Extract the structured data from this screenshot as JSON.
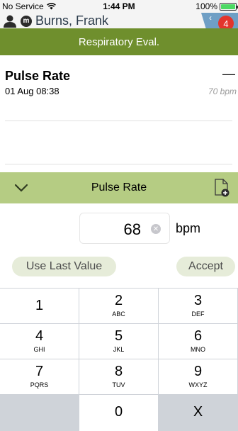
{
  "status_bar": {
    "carrier": "No Service",
    "time": "1:44 PM",
    "battery": "100%"
  },
  "patient": {
    "badge": "m",
    "name": "Burns, Frank",
    "notifications": "4"
  },
  "title": "Respiratory Eval.",
  "measurement": {
    "title": "Pulse Rate",
    "date": "01 Aug 08:38",
    "value": "—",
    "previous": "70 bpm"
  },
  "entry": {
    "title": "Pulse Rate",
    "value": "68",
    "unit": "bpm",
    "use_last_label": "Use Last Value",
    "accept_label": "Accept"
  },
  "keypad": [
    {
      "num": "1",
      "letters": ""
    },
    {
      "num": "2",
      "letters": "ABC"
    },
    {
      "num": "3",
      "letters": "DEF"
    },
    {
      "num": "4",
      "letters": "GHI"
    },
    {
      "num": "5",
      "letters": "JKL"
    },
    {
      "num": "6",
      "letters": "MNO"
    },
    {
      "num": "7",
      "letters": "PQRS"
    },
    {
      "num": "8",
      "letters": "TUV"
    },
    {
      "num": "9",
      "letters": "WXYZ"
    },
    {
      "num": "",
      "letters": ""
    },
    {
      "num": "0",
      "letters": ""
    },
    {
      "num": "X",
      "letters": ""
    }
  ],
  "colors": {
    "header_green": "#6f8f2d",
    "entry_green": "#b5cc83",
    "pill_bg": "#e6ecd9",
    "notification_red": "#e3352c",
    "tab_blue": "#6f9fc5"
  }
}
